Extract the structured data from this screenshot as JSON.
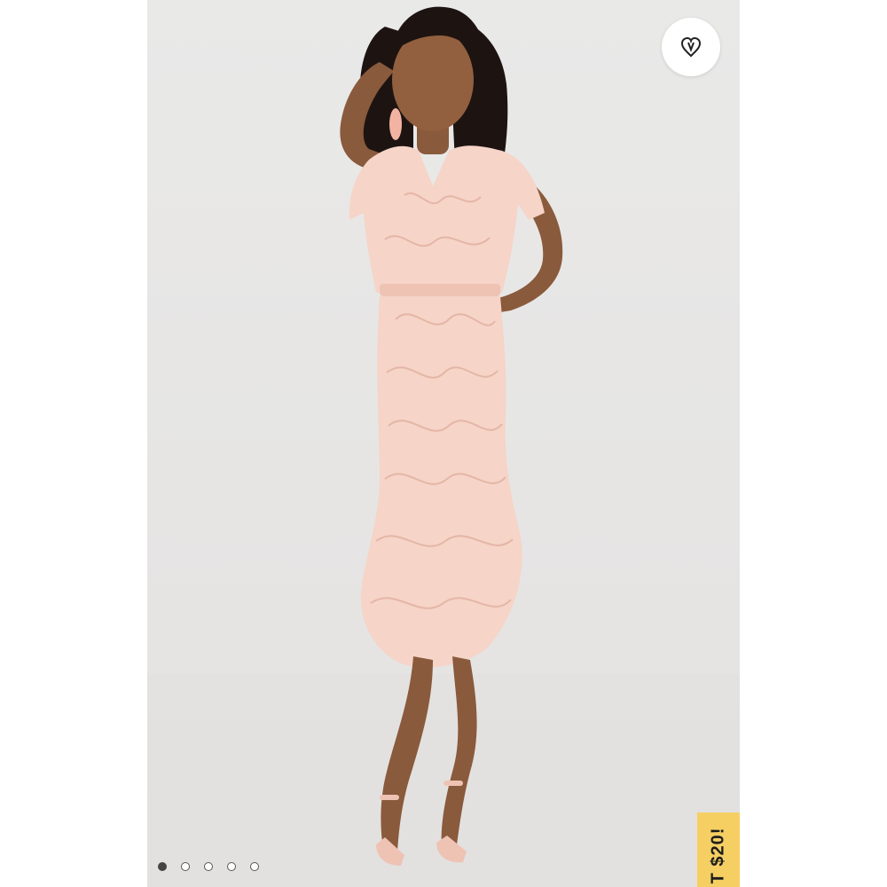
{
  "listing": {
    "image_subject": "model-in-blush-lace-midi-dress",
    "like_icon": "heart-icon",
    "promo_text": "T $20!",
    "carousel": {
      "count": 5,
      "active_index": 0
    }
  },
  "colors": {
    "background": "#e8e7e6",
    "dress": "#f6d4c8",
    "skin": "#8a5a3c",
    "hair": "#1d1412",
    "promo": "#f6cf63",
    "dot_active": "#444444"
  }
}
